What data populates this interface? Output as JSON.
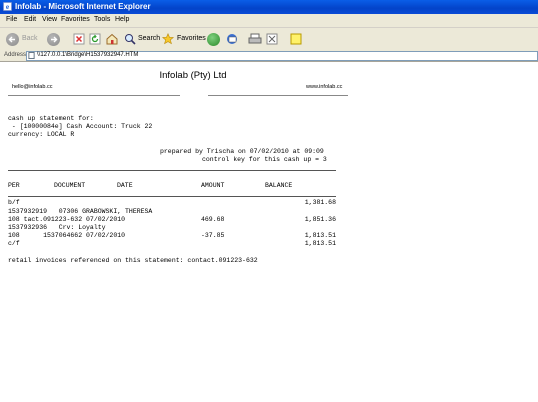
{
  "window": {
    "title": "Infolab - Microsoft Internet Explorer"
  },
  "menu": [
    "File",
    "Edit",
    "View",
    "Favorites",
    "Tools",
    "Help"
  ],
  "toolbar": {
    "back": "Back",
    "search": "Search",
    "favorites": "Favorites"
  },
  "address": {
    "label": "Address",
    "url": "\\\\127.0.0.1\\Bridge\\H1537932947.HTM"
  },
  "doc": {
    "company": "Infolab (Pty) Ltd",
    "email": "hello@infolab.cc",
    "website": "www.infolab.cc",
    "heading1": "cash up statement for:",
    "heading2": " - [10000084e] Cash Account: Truck 22",
    "currency": "currency: LOCAL R",
    "prepared": "prepared by Trischa on 07/02/2010 at 09:09",
    "controlkey": "control key for this cash up = 3",
    "columns": {
      "per": "PER",
      "document": "DOCUMENT",
      "date": "DATE",
      "amount": "AMOUNT",
      "balance": "BALANCE"
    },
    "rows": [
      {
        "left": "b/f",
        "amount": "",
        "balance": "1,381.68"
      },
      {
        "left": "1537932919   07306 GRABOWSKI, THERESA",
        "amount": "",
        "balance": ""
      },
      {
        "left": "108 tact.091223-632 07/02/2010",
        "amount": "469.68",
        "balance": "1,851.36"
      },
      {
        "left": "1537932936   Crv: Loyalty",
        "amount": "",
        "balance": ""
      },
      {
        "left": "108      1537064662 07/02/2010",
        "amount": "-37.85",
        "balance": "1,813.51"
      },
      {
        "left": "c/f",
        "amount": "",
        "balance": "1,813.51"
      }
    ],
    "footer": "retail invoices referenced on this statement: contact.091223-632"
  }
}
